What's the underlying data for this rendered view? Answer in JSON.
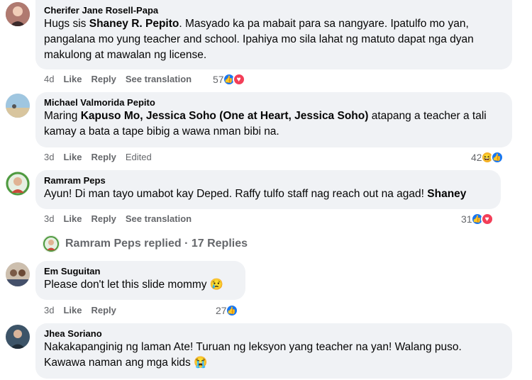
{
  "comments": [
    {
      "author": "Cherifer Jane Rosell-Papa",
      "text_parts": [
        "Hugs sis ",
        "Shaney R. Pepito",
        ". Masyado ka pa mabait para sa nangyare. Ipatulfo mo yan, pangalana mo yung teacher and school. Ipahiya mo sila lahat ng matuto dapat nga dyan makulong at mawalan ng license."
      ],
      "time": "4d",
      "like": "Like",
      "reply": "Reply",
      "extra": "See translation",
      "reaction_count": "57"
    },
    {
      "author": "Michael Valmorida Pepito",
      "text_parts": [
        "Maring ",
        "Kapuso Mo, Jessica Soho (One at Heart, Jessica Soho)",
        " atapang a teacher a tali kamay a bata a tape bibig a wawa nman bibi na."
      ],
      "time": "3d",
      "like": "Like",
      "reply": "Reply",
      "extra": "Edited",
      "reaction_count": "42"
    },
    {
      "author": "Ramram Peps",
      "text_parts": [
        "Ayun! Di man tayo umabot kay Deped. Raffy tulfo staff nag reach out na agad! ",
        "Shaney"
      ],
      "time": "3d",
      "like": "Like",
      "reply": "Reply",
      "extra": "See translation",
      "reaction_count": "31"
    },
    {
      "author": "Em Suguitan",
      "text": "Please don't let this slide mommy 😢",
      "time": "3d",
      "like": "Like",
      "reply": "Reply",
      "reaction_count": "27"
    },
    {
      "author": "Jhea Soriano",
      "text": "Nakakapanginig ng laman Ate! Turuan ng leksyon yang teacher na yan! Walang puso. Kawawa naman ang mga kids 😭"
    }
  ],
  "replies_link": "Ramram Peps replied · 17 Replies"
}
